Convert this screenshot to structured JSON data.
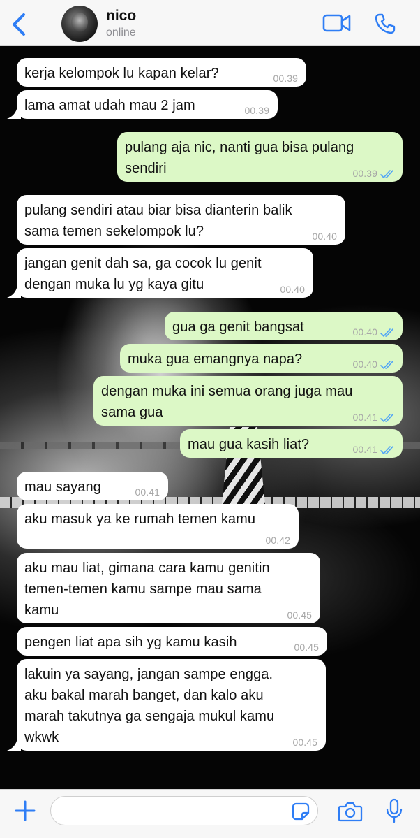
{
  "header": {
    "contact_name": "nico",
    "contact_status": "online",
    "back_icon": "chevron-left-icon",
    "video_icon": "video-camera-icon",
    "phone_icon": "phone-icon",
    "accent_color": "#2f7ef5"
  },
  "messages": [
    {
      "dir": "in",
      "text": "kerja kelompok lu kapan kelar?",
      "time": "00.39",
      "tail": false
    },
    {
      "dir": "in",
      "text": "lama amat udah mau 2 jam",
      "time": "00.39",
      "tail": true
    },
    {
      "dir": "out",
      "text": "pulang aja nic, nanti gua bisa pulang sendiri",
      "time": "00.39",
      "read": true
    },
    {
      "dir": "in",
      "text": "pulang sendiri atau biar bisa dianterin balik sama temen sekelompok lu?",
      "time": "00.40",
      "tail": false
    },
    {
      "dir": "in",
      "text": "jangan genit dah sa, ga cocok lu genit dengan muka lu yg kaya gitu",
      "time": "00.40",
      "tail": true
    },
    {
      "dir": "out",
      "text": "gua ga genit bangsat",
      "time": "00.40",
      "read": true
    },
    {
      "dir": "out",
      "text": "muka gua emangnya napa?",
      "time": "00.40",
      "read": true
    },
    {
      "dir": "out",
      "text": "dengan muka ini semua orang juga mau sama gua",
      "time": "00.41",
      "read": true
    },
    {
      "dir": "out",
      "text": "mau gua kasih liat?",
      "time": "00.41",
      "read": true
    },
    {
      "dir": "in",
      "text": "mau sayang",
      "time": "00.41",
      "tail": false
    },
    {
      "dir": "in",
      "text": "aku masuk ya ke rumah temen kamu",
      "time": "00.42",
      "tail": false
    },
    {
      "dir": "in",
      "text": "aku mau liat, gimana cara kamu genitin temen-temen kamu sampe mau sama kamu",
      "time": "00.45",
      "tail": false
    },
    {
      "dir": "in",
      "text": "pengen liat apa sih yg kamu kasih",
      "time": "00.45",
      "tail": false
    },
    {
      "dir": "in",
      "text": "lakuin ya sayang, jangan sampe engga. aku bakal marah banget, dan kalo aku marah takutnya ga sengaja mukul kamu wkwk",
      "time": "00.45",
      "tail": true
    }
  ],
  "colors": {
    "incoming_bubble": "#ffffff",
    "outgoing_bubble": "#dcf8c6",
    "read_ticks": "#4fa3f7",
    "timestamp": "#a7a7a7"
  },
  "input_bar": {
    "message_value": "",
    "plus_icon": "plus-icon",
    "sticker_icon": "sticker-icon",
    "camera_icon": "camera-icon",
    "mic_icon": "microphone-icon"
  }
}
